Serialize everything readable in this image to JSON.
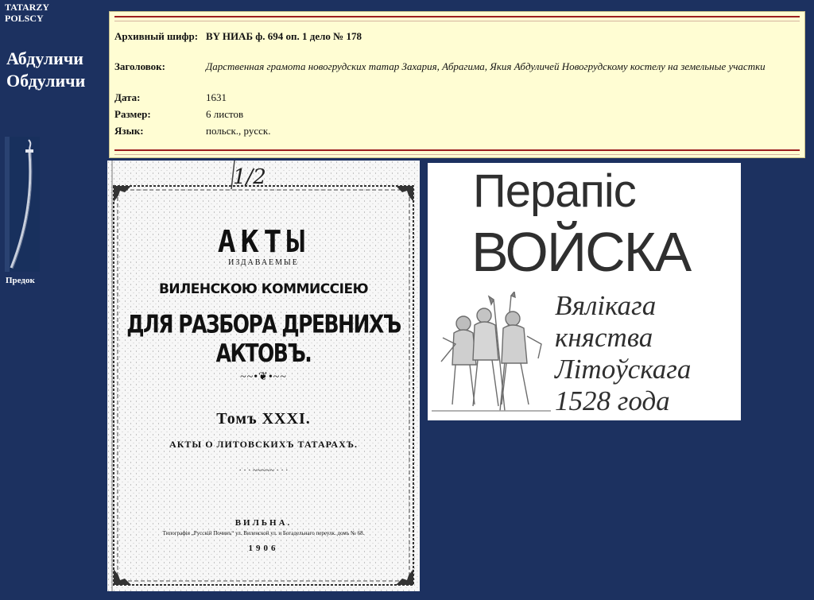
{
  "sidebar": {
    "site_title_line1": "TATARZY",
    "site_title_line2": "POLSCY",
    "family_name_line1": "Абдуличи",
    "family_name_line2": "Обдуличи",
    "ancestor_label": "Предок",
    "ancestor_icon": "saber-icon"
  },
  "record": {
    "archive_code_label": "Архивный шифр:",
    "archive_code_value": "BY НИАБ ф. 694 оп. 1 дело № 178",
    "title_label": "Заголовок:",
    "title_value": "Дарственная грамота новогрудских татар Захария, Абрагима, Якия Абдуличей Новогрудскому костелу на земельные участки",
    "date_label": "Дата:",
    "date_value": "1631",
    "size_label": "Размер:",
    "size_value": "6 листов",
    "language_label": "Язык:",
    "language_value": "польск., русск.",
    "accent_color": "#9c1f1f",
    "background_color": "#fffdd3"
  },
  "scan": {
    "handwritten_number": "1/2",
    "title": "АКТЫ",
    "published_by": "издаваемые",
    "commission": "ВИЛЕНСКОЮ КОММИССІЕЮ",
    "purpose": "ДЛЯ РАЗБОРА ДРЕВНИХЪ АКТОВЪ.",
    "volume": "Томъ XXXI.",
    "subtitle": "АКТЫ О ЛИТОВСКИХЪ ТАТАРАХЪ.",
    "city": "ВИЛЬНА.",
    "press_line": "Типографія „Русскій Починъ“ ул. Виленской ул. и Богадельнаго переулк. домъ № 68.",
    "year": "1906"
  },
  "book": {
    "line1": "Перапіс",
    "line2": "ВОЙСКА",
    "line3": "Вялікага",
    "line4": "княства",
    "line5": "Літоўскага",
    "line6": "1528 года"
  },
  "colors": {
    "page_background": "#1c3160",
    "sidebar_text": "#ffffff"
  }
}
